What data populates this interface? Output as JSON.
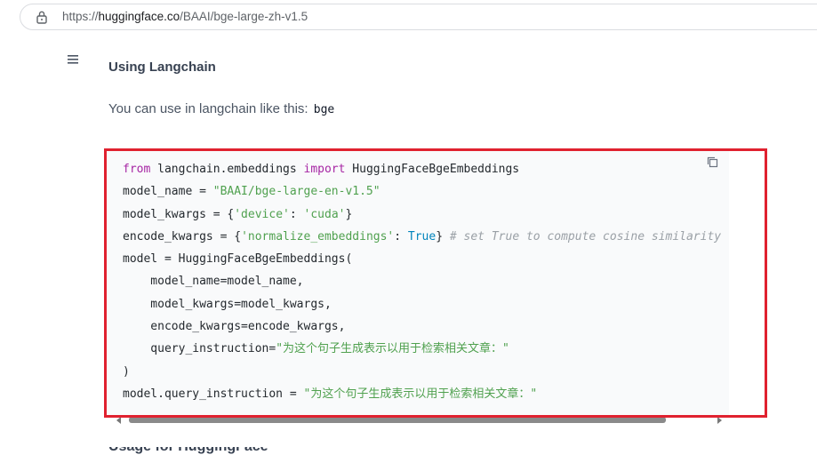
{
  "browser": {
    "url_prefix": "https://",
    "url_host": "huggingface.co",
    "url_path": "/BAAI/bge-large-zh-v1.5"
  },
  "content": {
    "section_title": "Using Langchain",
    "paragraph": "You can use in langchain like this:",
    "inline_code": "bge",
    "next_heading": "Usage for HuggingFace"
  },
  "code_block": {
    "language": "python",
    "copy_icon": "copy-icon",
    "lines": [
      [
        {
          "t": "from",
          "c": "kw"
        },
        {
          "t": " langchain.embeddings ",
          "c": ""
        },
        {
          "t": "import",
          "c": "kw"
        },
        {
          "t": " HuggingFaceBgeEmbeddings",
          "c": ""
        }
      ],
      [
        {
          "t": "model_name = ",
          "c": ""
        },
        {
          "t": "\"BAAI/bge-large-en-v1.5\"",
          "c": "str"
        }
      ],
      [
        {
          "t": "model_kwargs = {",
          "c": ""
        },
        {
          "t": "'device'",
          "c": "str"
        },
        {
          "t": ": ",
          "c": ""
        },
        {
          "t": "'cuda'",
          "c": "str"
        },
        {
          "t": "}",
          "c": ""
        }
      ],
      [
        {
          "t": "encode_kwargs = {",
          "c": ""
        },
        {
          "t": "'normalize_embeddings'",
          "c": "str"
        },
        {
          "t": ": ",
          "c": ""
        },
        {
          "t": "True",
          "c": "lit"
        },
        {
          "t": "} ",
          "c": ""
        },
        {
          "t": "# set True to compute cosine similarity",
          "c": "cmt"
        }
      ],
      [
        {
          "t": "model = HuggingFaceBgeEmbeddings(",
          "c": ""
        }
      ],
      [
        {
          "t": "    model_name=model_name,",
          "c": ""
        }
      ],
      [
        {
          "t": "    model_kwargs=model_kwargs,",
          "c": ""
        }
      ],
      [
        {
          "t": "    encode_kwargs=encode_kwargs,",
          "c": ""
        }
      ],
      [
        {
          "t": "    query_instruction=",
          "c": ""
        },
        {
          "t": "\"为这个句子生成表示以用于检索相关文章：\"",
          "c": "str"
        }
      ],
      [
        {
          "t": ")",
          "c": ""
        }
      ],
      [
        {
          "t": "model.query_instruction = ",
          "c": ""
        },
        {
          "t": "\"为这个句子生成表示以用于检索相关文章：\"",
          "c": "str"
        }
      ]
    ]
  },
  "colors": {
    "highlight_border": "#e0212f",
    "keyword": "#a626a4",
    "string": "#50a14f",
    "literal": "#0184bc",
    "comment": "#9aa0a6"
  }
}
